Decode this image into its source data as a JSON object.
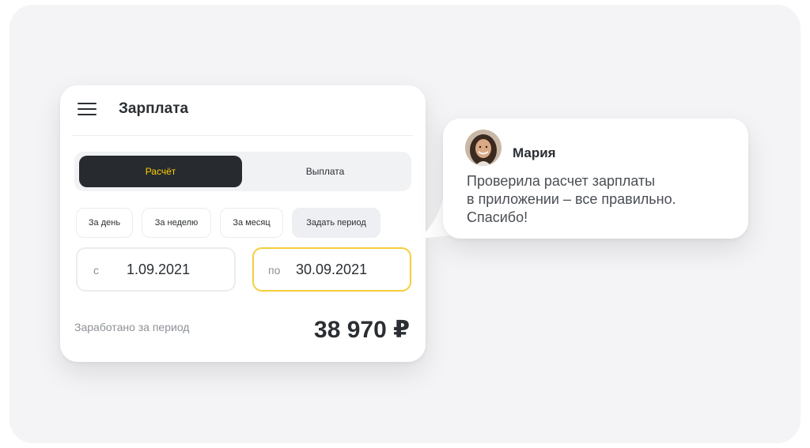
{
  "header": {
    "title": "Зарплата"
  },
  "segmented": {
    "calc_label": "Расчёт",
    "payout_label": "Выплата"
  },
  "period_chips": {
    "day": "За день",
    "week": "За неделю",
    "month": "За месяц",
    "custom": "Задать период"
  },
  "date_range": {
    "from_prefix": "с",
    "from_value": "1.09.2021",
    "to_prefix": "по",
    "to_value": "30.09.2021"
  },
  "summary": {
    "label": "Заработано за период",
    "amount": "38 970 ₽"
  },
  "review": {
    "author": "Мария",
    "message_line1": "Проверила расчет зарплаты",
    "message_line2": "в приложении – все правильно.",
    "message_line3": "Спасибо!"
  },
  "colors": {
    "accent": "#ffcc00",
    "dark": "#272b30",
    "focus_border": "#f5cd3c"
  },
  "icons": {
    "menu": "hamburger-menu-icon"
  }
}
